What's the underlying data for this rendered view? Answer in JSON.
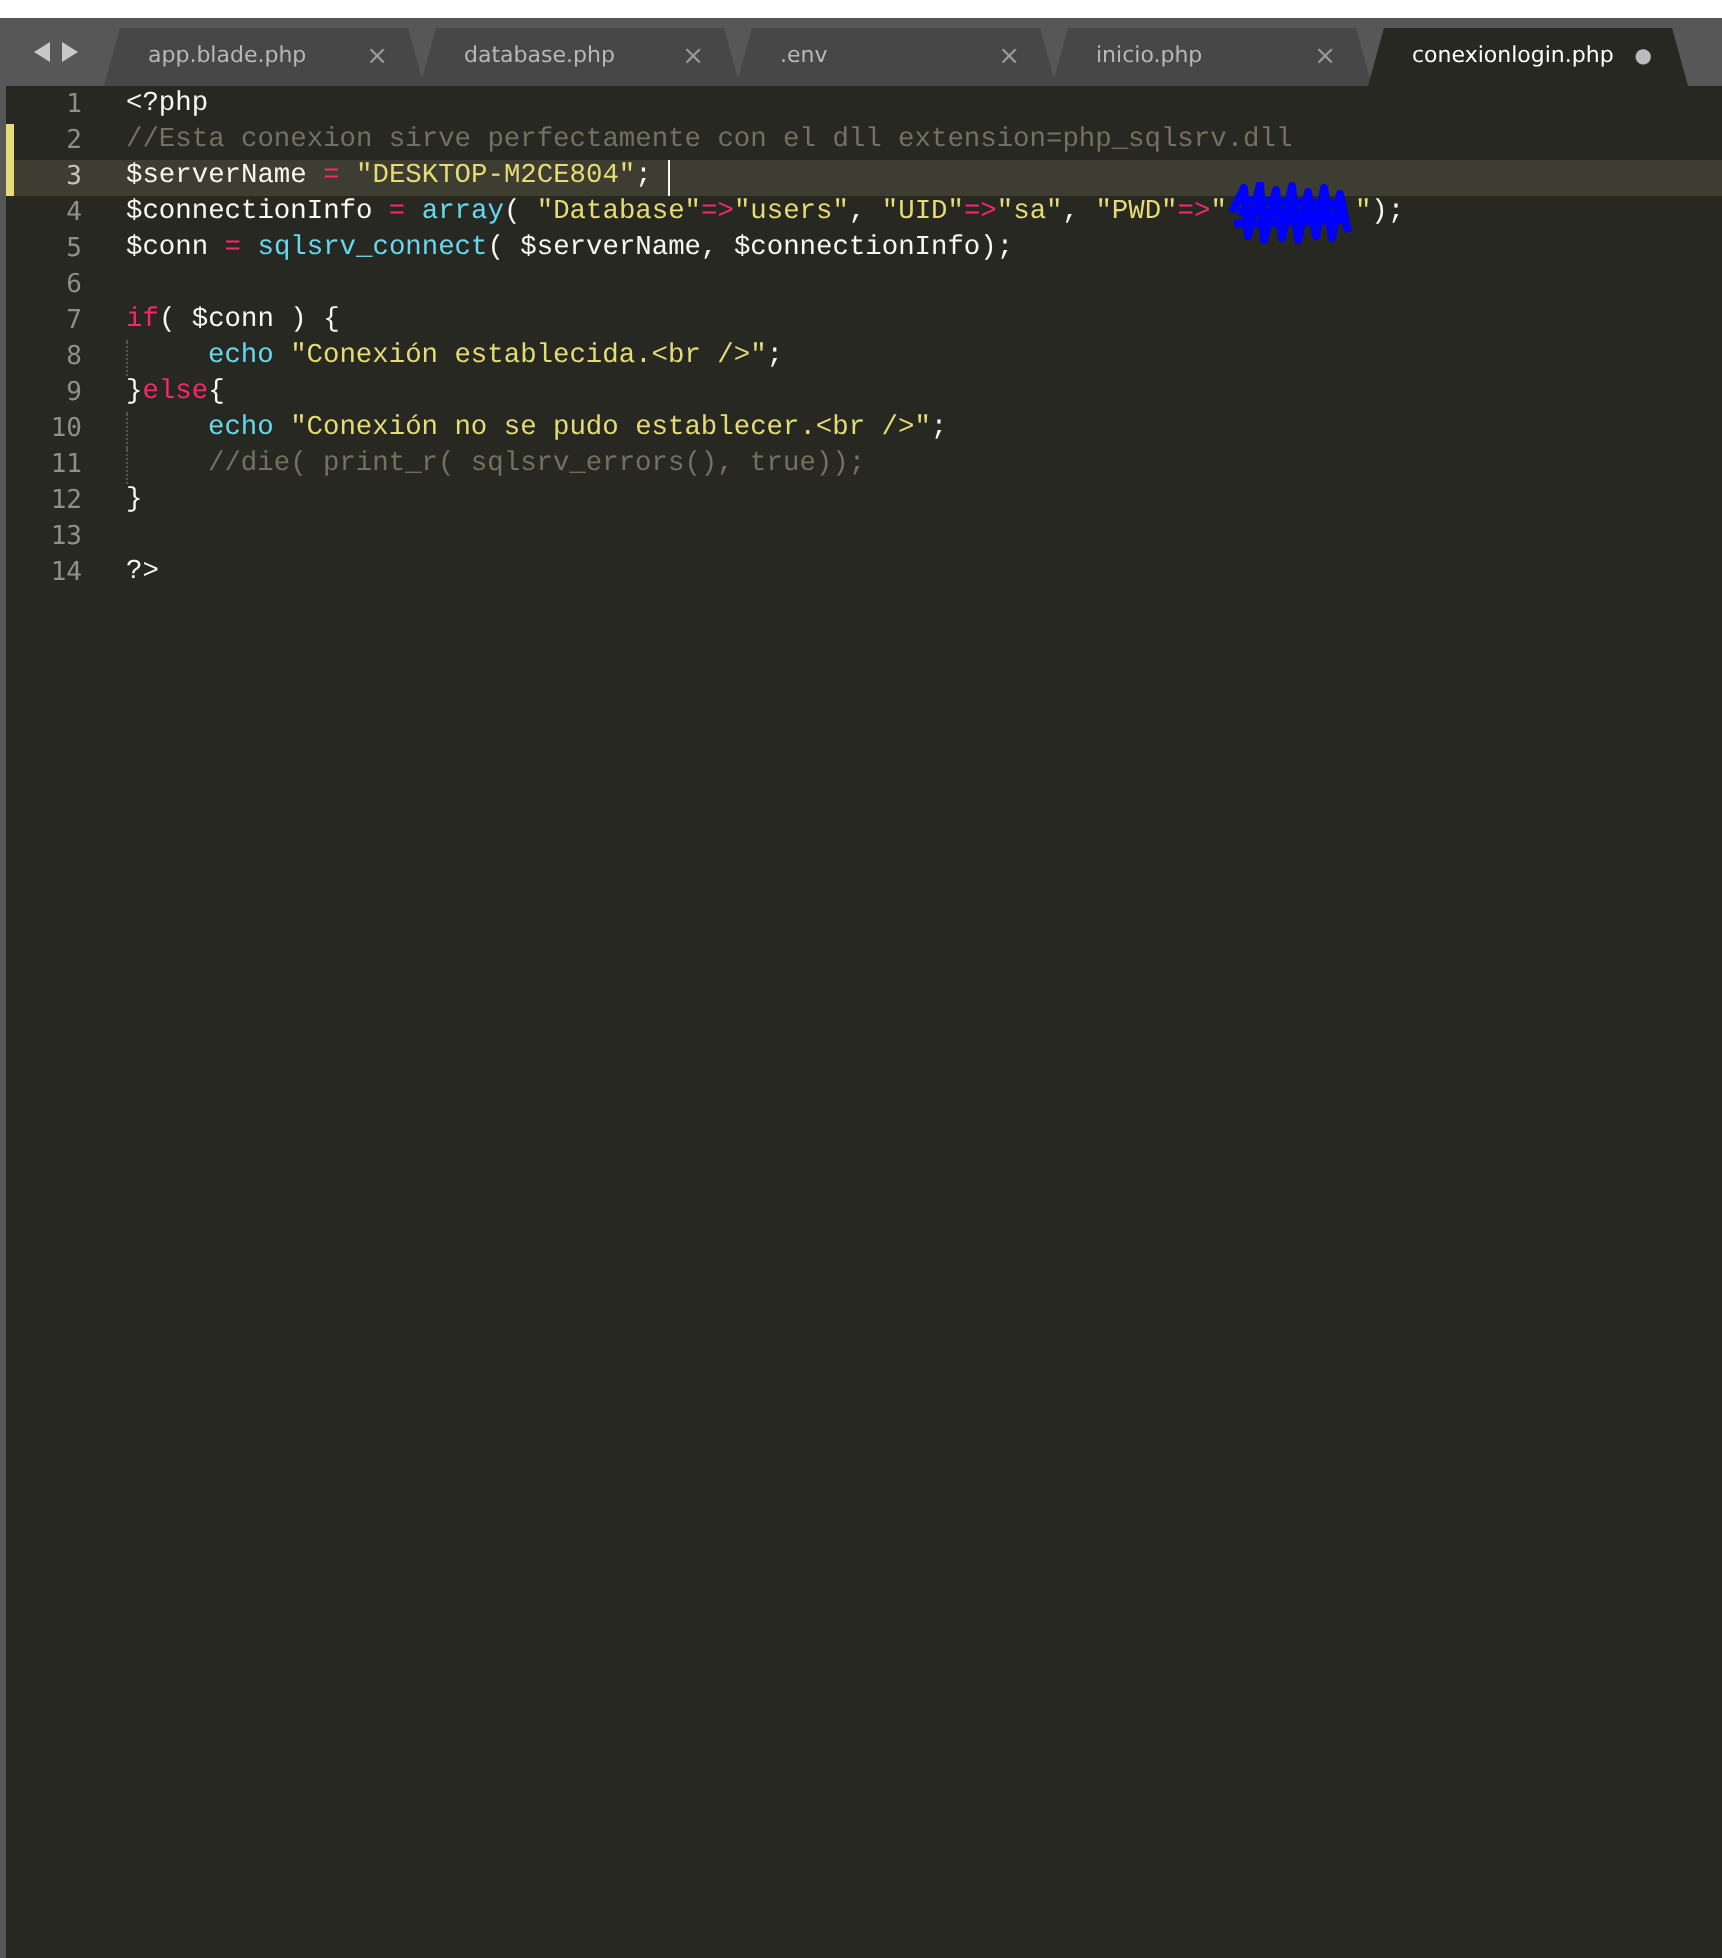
{
  "tabs": [
    {
      "label": "app.blade.php",
      "selected": false,
      "close": "×",
      "dirty": false
    },
    {
      "label": "database.php",
      "selected": false,
      "close": "×",
      "dirty": false
    },
    {
      "label": ".env",
      "selected": false,
      "close": "×",
      "dirty": false
    },
    {
      "label": "inicio.php",
      "selected": false,
      "close": "×",
      "dirty": false
    },
    {
      "label": "conexionlogin.php",
      "selected": true,
      "close": "●",
      "dirty": true
    }
  ],
  "editor": {
    "lines": [
      {
        "number": "1",
        "modified": false,
        "current": false,
        "indented": false,
        "tokens": [
          {
            "kind": "plain",
            "text": "<?php"
          }
        ]
      },
      {
        "number": "2",
        "modified": true,
        "current": false,
        "indented": false,
        "tokens": [
          {
            "kind": "comment",
            "text": "//Esta conexion sirve perfectamente con el dll extension=php_sqlsrv.dll"
          }
        ]
      },
      {
        "number": "3",
        "modified": true,
        "current": true,
        "indented": false,
        "tokens": [
          {
            "kind": "plain",
            "text": "$serverName "
          },
          {
            "kind": "operator",
            "text": "= "
          },
          {
            "kind": "string",
            "text": "\"DESKTOP-M2CE804\""
          },
          {
            "kind": "plain",
            "text": "; "
          },
          {
            "kind": "cursor"
          }
        ]
      },
      {
        "number": "4",
        "modified": false,
        "current": false,
        "indented": false,
        "tokens": [
          {
            "kind": "plain",
            "text": "$connectionInfo "
          },
          {
            "kind": "operator",
            "text": "= "
          },
          {
            "kind": "function",
            "text": "array"
          },
          {
            "kind": "plain",
            "text": "( "
          },
          {
            "kind": "string",
            "text": "\"Database\""
          },
          {
            "kind": "operator",
            "text": "=>"
          },
          {
            "kind": "string",
            "text": "\"users\""
          },
          {
            "kind": "plain",
            "text": ", "
          },
          {
            "kind": "string",
            "text": "\"UID\""
          },
          {
            "kind": "operator",
            "text": "=>"
          },
          {
            "kind": "string",
            "text": "\"sa\""
          },
          {
            "kind": "plain",
            "text": ", "
          },
          {
            "kind": "string",
            "text": "\"PWD\""
          },
          {
            "kind": "operator",
            "text": "=>"
          },
          {
            "kind": "string",
            "text": "\""
          },
          {
            "kind": "redacted"
          },
          {
            "kind": "string",
            "text": "\""
          },
          {
            "kind": "plain",
            "text": ");"
          }
        ]
      },
      {
        "number": "5",
        "modified": false,
        "current": false,
        "indented": false,
        "tokens": [
          {
            "kind": "plain",
            "text": "$conn "
          },
          {
            "kind": "operator",
            "text": "= "
          },
          {
            "kind": "function",
            "text": "sqlsrv_connect"
          },
          {
            "kind": "plain",
            "text": "( $serverName, $connectionInfo);"
          }
        ]
      },
      {
        "number": "6",
        "modified": false,
        "current": false,
        "indented": false
      },
      {
        "number": "7",
        "modified": false,
        "current": false,
        "indented": false,
        "tokens": [
          {
            "kind": "keyword",
            "text": "if"
          },
          {
            "kind": "plain",
            "text": "( $conn ) {"
          }
        ]
      },
      {
        "number": "8",
        "modified": false,
        "current": false,
        "indented": true,
        "tokens": [
          {
            "kind": "function",
            "text": "echo "
          },
          {
            "kind": "string",
            "text": "\"Conexión establecida.<br />\""
          },
          {
            "kind": "plain",
            "text": ";"
          }
        ]
      },
      {
        "number": "9",
        "modified": false,
        "current": false,
        "indented": false,
        "tokens": [
          {
            "kind": "plain",
            "text": "}"
          },
          {
            "kind": "keyword",
            "text": "else"
          },
          {
            "kind": "plain",
            "text": "{"
          }
        ]
      },
      {
        "number": "10",
        "modified": false,
        "current": false,
        "indented": true,
        "tokens": [
          {
            "kind": "function",
            "text": "echo "
          },
          {
            "kind": "string",
            "text": "\"Conexión no se pudo establecer.<br />\""
          },
          {
            "kind": "plain",
            "text": ";"
          }
        ]
      },
      {
        "number": "11",
        "modified": false,
        "current": false,
        "indented": true,
        "tokens": [
          {
            "kind": "comment",
            "text": "//die( print_r( sqlsrv_errors(), true));"
          }
        ]
      },
      {
        "number": "12",
        "modified": false,
        "current": false,
        "indented": false,
        "tokens": [
          {
            "kind": "plain",
            "text": "}"
          }
        ]
      },
      {
        "number": "13",
        "modified": false,
        "current": false,
        "indented": false
      },
      {
        "number": "14",
        "modified": false,
        "current": false,
        "indented": false,
        "tokens": [
          {
            "kind": "plain",
            "text": "?>"
          }
        ]
      }
    ]
  }
}
